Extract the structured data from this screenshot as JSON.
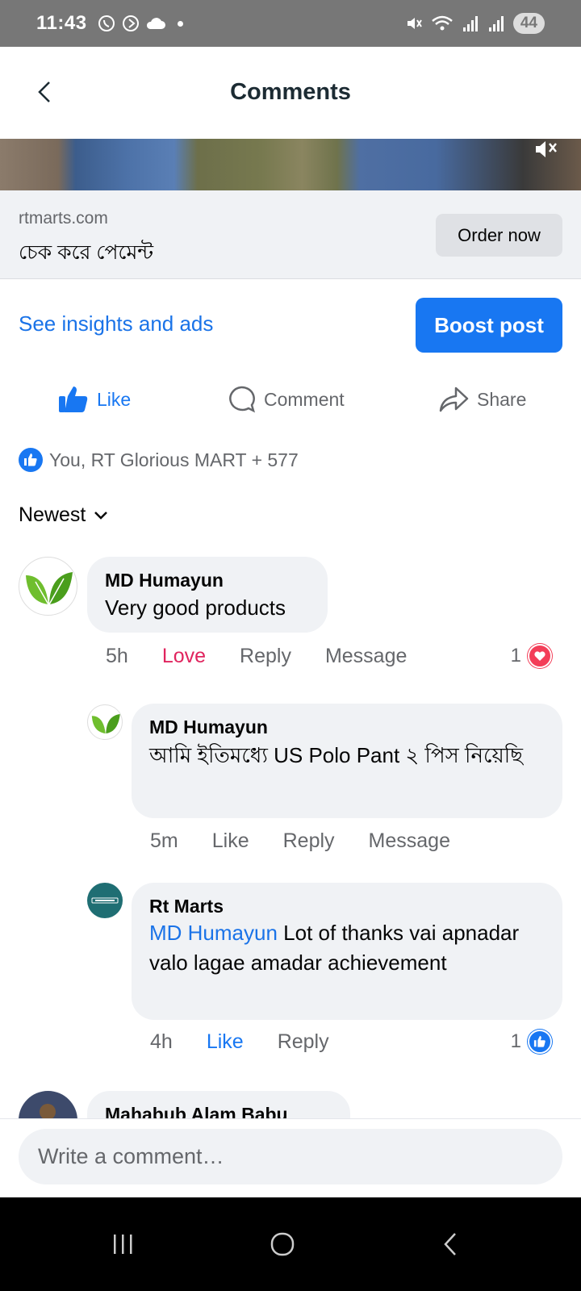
{
  "status_bar": {
    "time": "11:43",
    "battery": "44"
  },
  "header": {
    "title": "Comments"
  },
  "link_preview": {
    "domain": "rtmarts.com",
    "subtitle": "চেক করে পেমেন্ট",
    "order_label": "Order now"
  },
  "insights": {
    "link_label": "See insights and ads",
    "boost_label": "Boost post"
  },
  "actions": {
    "like": "Like",
    "comment": "Comment",
    "share": "Share"
  },
  "reactions": {
    "summary": "You, RT Glorious MART + 577"
  },
  "sort": {
    "label": "Newest"
  },
  "comments": [
    {
      "author": "MD Humayun",
      "text": "Very good products",
      "time": "5h",
      "reaction_action": "Love",
      "reply": "Reply",
      "message": "Message",
      "reaction_count": "1"
    },
    {
      "author": "MD Humayun",
      "text": "আমি ইতিমধ্যে US Polo Pant ২ পিস নিয়েছি",
      "time": "5m",
      "reaction_action": "Like",
      "reply": "Reply",
      "message": "Message"
    },
    {
      "author": "Rt Marts",
      "mention": "MD Humayun",
      "text": "Lot of thanks vai apnadar valo lagae amadar achievement",
      "time": "4h",
      "reaction_action": "Like",
      "reply": "Reply",
      "reaction_count": "1"
    },
    {
      "author": "Mahabub Alam Babu"
    }
  ],
  "composer": {
    "placeholder": "Write a comment…"
  },
  "colors": {
    "brand_blue": "#1877f2",
    "love_red": "#e0245e",
    "bubble_bg": "#f0f2f5"
  }
}
